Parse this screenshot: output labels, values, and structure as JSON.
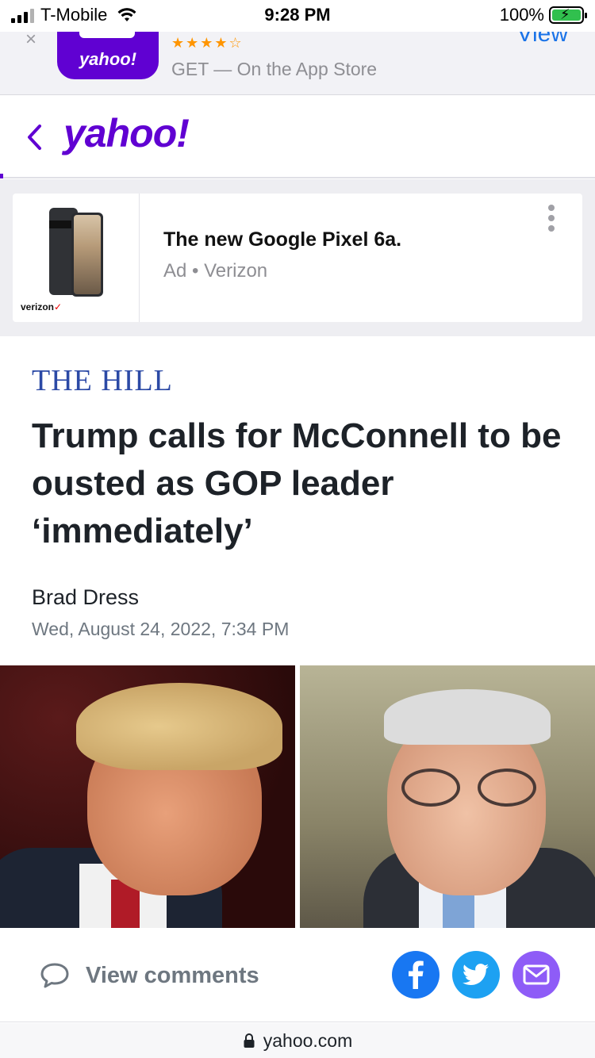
{
  "status_bar": {
    "carrier": "T-Mobile",
    "time": "9:28 PM",
    "battery": "100%"
  },
  "app_banner": {
    "close_icon": "close-icon",
    "app_name": "yahoo!",
    "rating_stars": "★★★★☆",
    "cta_text": "GET — On the App Store",
    "view_label": "View"
  },
  "header": {
    "logo_text": "yahoo!",
    "back_icon": "chevron-left-icon"
  },
  "ad": {
    "brand": "verizon",
    "title": "The new Google Pixel 6a.",
    "meta": "Ad • Verizon",
    "more_icon": "more-vertical-icon"
  },
  "article": {
    "publisher": "THE HILL",
    "headline": "Trump calls for McConnell to be ousted as GOP leader ‘immediately’",
    "author": "Brad Dress",
    "date": "Wed, August 24, 2022, 7:34 PM"
  },
  "actions": {
    "comments_label": "View comments",
    "comment_icon": "comment-icon",
    "share": [
      "facebook-icon",
      "twitter-icon",
      "mail-icon"
    ]
  },
  "url_bar": {
    "url": "yahoo.com",
    "lock_icon": "lock-icon"
  },
  "colors": {
    "yahoo_purple": "#6001d2",
    "publisher_blue": "#2c4aa6",
    "facebook": "#1877f2",
    "twitter": "#1da1f2",
    "mail": "#8e5cf7"
  }
}
